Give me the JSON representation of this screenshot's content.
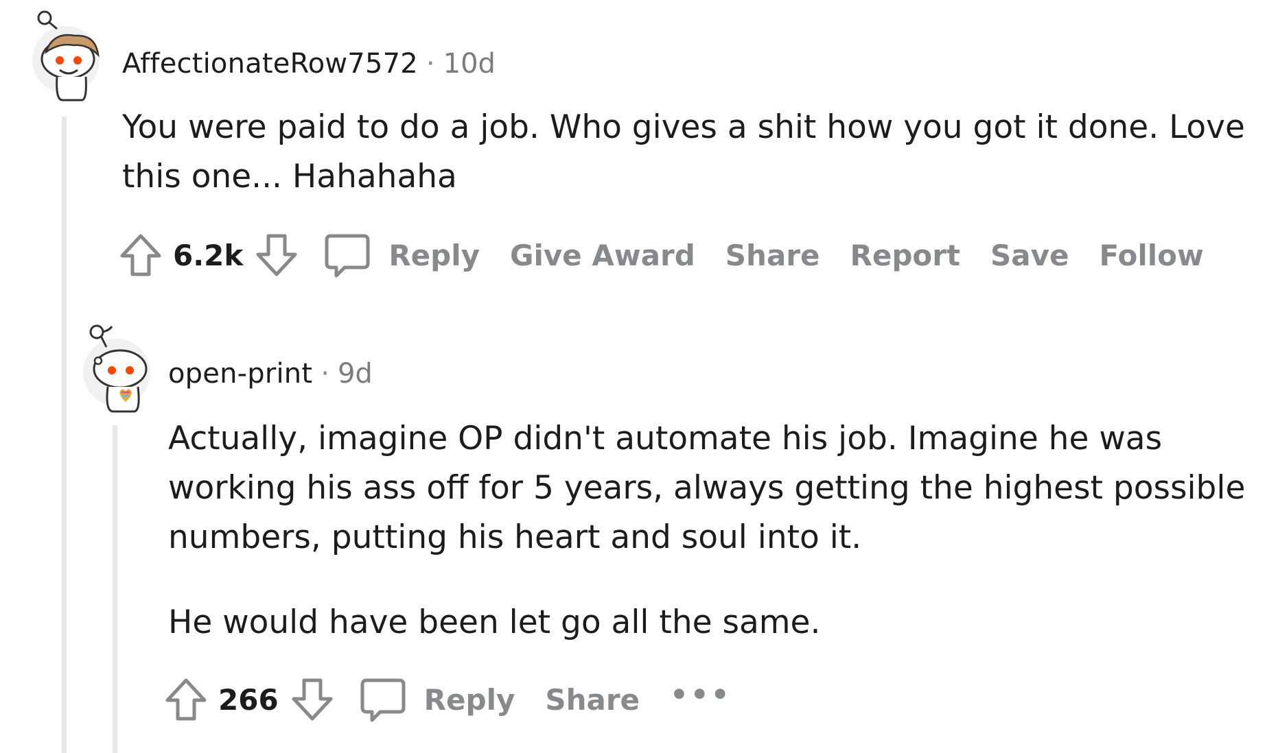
{
  "comments": [
    {
      "username": "AffectionateRow7572",
      "separator": "·",
      "age": "10d",
      "body": [
        "You were paid to do a job. Who gives a shit how you got it done. Love",
        "this one... Hahahaha"
      ],
      "score": "6.2k",
      "actions": [
        "Reply",
        "Give Award",
        "Share",
        "Report",
        "Save",
        "Follow"
      ],
      "avatar_icon": "snoo-avatar-brown-hair"
    },
    {
      "username": "open-print",
      "separator": "·",
      "age": "9d",
      "paragraph1": [
        "Actually, imagine OP didn't automate his job. Imagine he was",
        "working his ass off for 5 years, always getting the highest possible",
        "numbers, putting his heart and soul into it."
      ],
      "paragraph2": "He would have been let go all the same.",
      "score": "266",
      "actions": [
        "Reply",
        "Share"
      ],
      "more": "•••",
      "avatar_icon": "snoo-avatar-rainbow-heart"
    }
  ],
  "colors": {
    "text": "#1c1c1c",
    "muted": "#878a8c",
    "thread_line": "#e8e8e8",
    "avatar_eye": "#ff4500"
  }
}
